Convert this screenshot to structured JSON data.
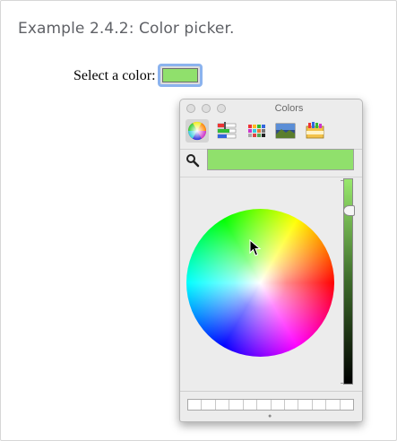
{
  "page": {
    "title": "Example 2.4.2: Color picker."
  },
  "form": {
    "label": "Select a color:",
    "selected_color": "#90e06c"
  },
  "panel": {
    "title": "Colors",
    "tools": [
      {
        "name": "color-wheel",
        "icon": "color-wheel-icon",
        "selected": true
      },
      {
        "name": "color-sliders",
        "icon": "sliders-icon",
        "selected": false
      },
      {
        "name": "color-palettes",
        "icon": "palette-icon",
        "selected": false
      },
      {
        "name": "image-palettes",
        "icon": "image-icon",
        "selected": false
      },
      {
        "name": "pencils",
        "icon": "crayons-icon",
        "selected": false
      }
    ],
    "current_color": "#90e06c",
    "brightness_slider": {
      "top_color": "#98e86c",
      "bottom_color": "#000000"
    },
    "swatch_slots": 12
  }
}
